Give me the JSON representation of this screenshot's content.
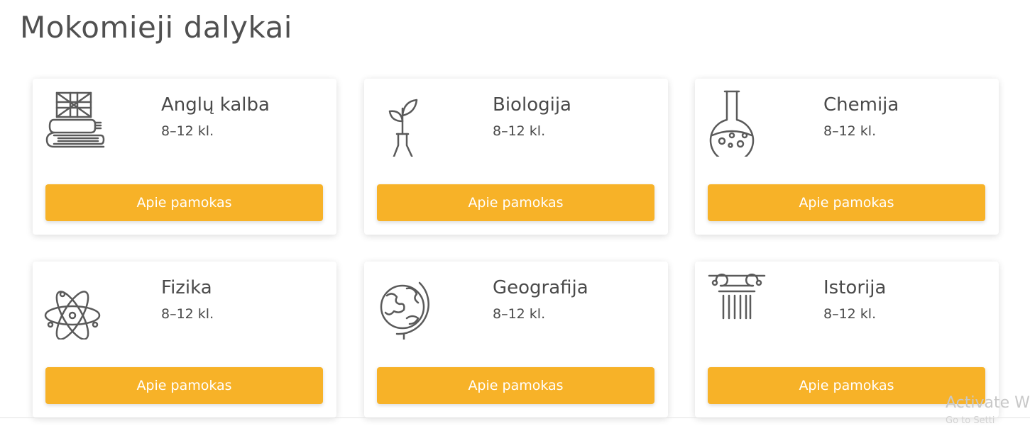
{
  "page": {
    "title": "Mokomieji dalykai"
  },
  "subjects": [
    {
      "name": "Anglų kalba",
      "grades": "8–12 kl.",
      "icon": "english-book-flag-icon",
      "button": "Apie pamokas"
    },
    {
      "name": "Biologija",
      "grades": "8–12 kl.",
      "icon": "plant-flask-icon",
      "button": "Apie pamokas"
    },
    {
      "name": "Chemija",
      "grades": "8–12 kl.",
      "icon": "chemistry-flask-icon",
      "button": "Apie pamokas"
    },
    {
      "name": "Fizika",
      "grades": "8–12 kl.",
      "icon": "atom-icon",
      "button": "Apie pamokas"
    },
    {
      "name": "Geografija",
      "grades": "8–12 kl.",
      "icon": "globe-icon",
      "button": "Apie pamokas"
    },
    {
      "name": "Istorija",
      "grades": "8–12 kl.",
      "icon": "column-icon",
      "button": "Apie pamokas"
    }
  ],
  "os_watermark": {
    "text": "Activate W",
    "subtext": "Go to Setti"
  },
  "colors": {
    "accent": "#f7b228",
    "text": "#4a4a4a",
    "icon_stroke": "#5a5a5a"
  }
}
